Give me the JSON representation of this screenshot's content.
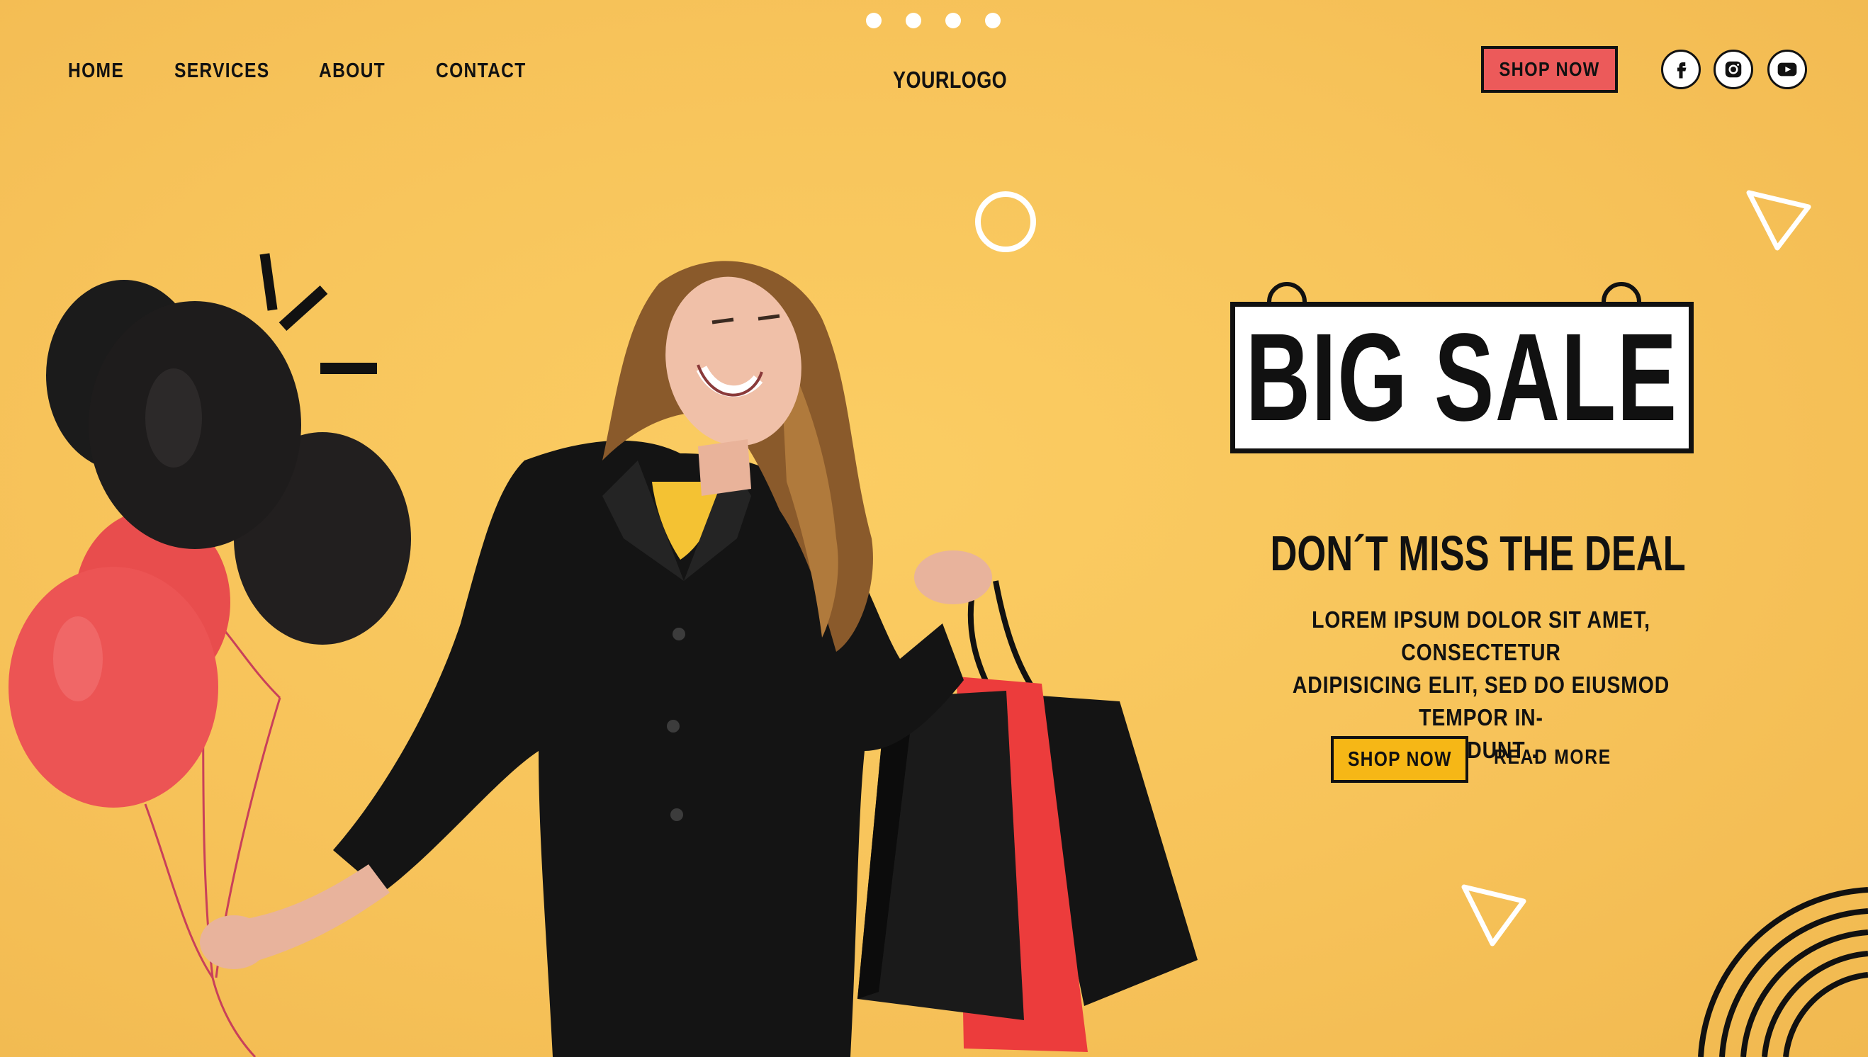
{
  "carousel": {
    "dot_count": 4
  },
  "nav": {
    "items": [
      {
        "label": "HOME"
      },
      {
        "label": "SERVICES"
      },
      {
        "label": "ABOUT"
      },
      {
        "label": "CONTACT"
      }
    ]
  },
  "logo": {
    "text": "YOURLOGO"
  },
  "header": {
    "shop_now_label": "SHOP NOW",
    "social": [
      {
        "icon": "facebook-icon"
      },
      {
        "icon": "instagram-icon"
      },
      {
        "icon": "youtube-icon"
      }
    ]
  },
  "hero": {
    "sign_text": "BIG SALE",
    "headline": "DON´T MISS THE DEAL",
    "body_line_1": "LOREM IPSUM DOLOR SIT AMET, CONSECTETUR",
    "body_line_2": "ADIPISICING ELIT, SED DO EIUSMOD TEMPOR IN-",
    "body_line_3": "CIDIDUNT .",
    "shop_now_label": "SHOP NOW",
    "read_more_label": "READ MORE"
  },
  "colors": {
    "background": "#f8c75c",
    "accent_red": "#ec5a5a",
    "accent_yellow": "#f6b716",
    "ink": "#111111"
  }
}
